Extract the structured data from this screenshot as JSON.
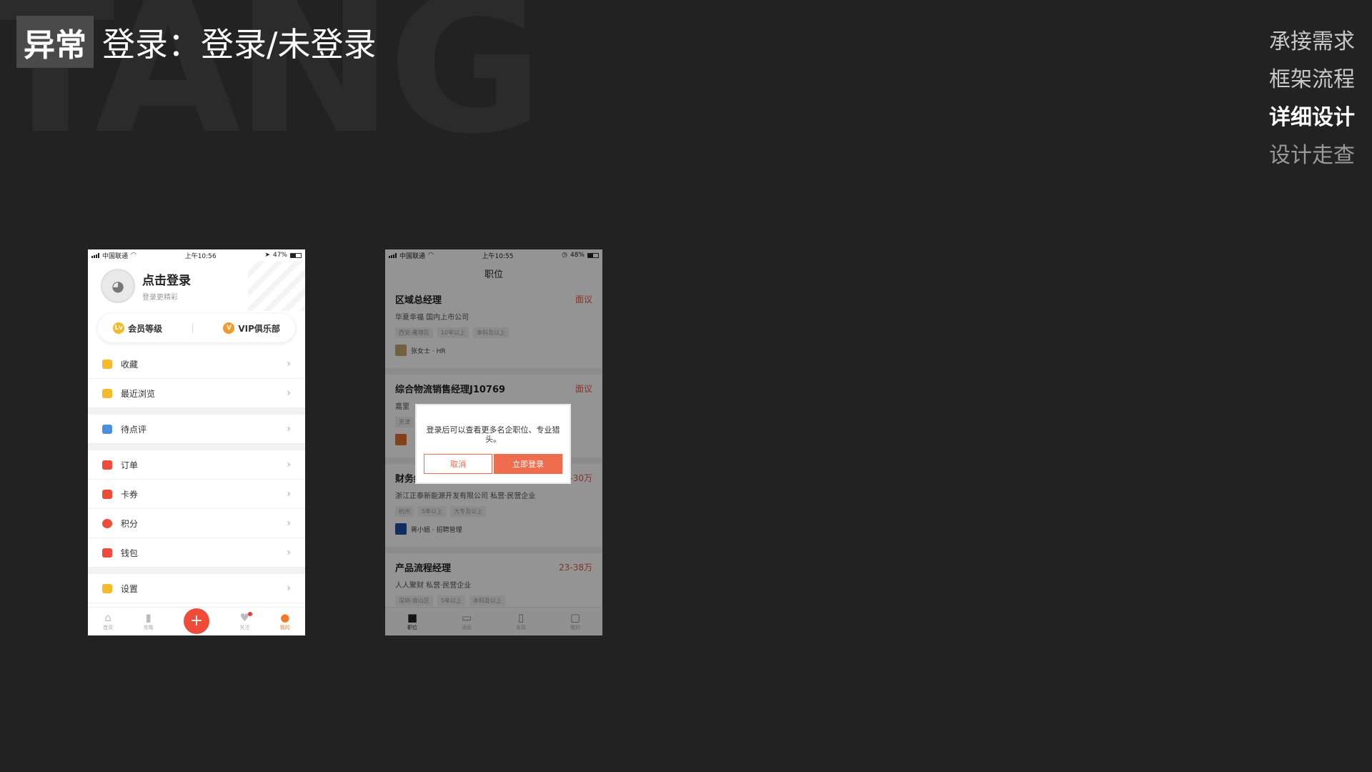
{
  "slide": {
    "watermark": "TANG",
    "tag": "异常",
    "title": "登录：登录/未登录"
  },
  "side_nav": [
    "承接需求",
    "框架流程",
    "详细设计",
    "设计走查"
  ],
  "phone1": {
    "status": {
      "carrier": "中国联通",
      "time": "上午10:56",
      "battery": "47%",
      "battery_level": 0.47
    },
    "profile": {
      "title": "点击登录",
      "subtitle": "登录更精彩",
      "avatar_icon": "avatar-icon"
    },
    "vip": {
      "level_label": "会员等级",
      "club_label": "VIP俱乐部",
      "level_badge": "Lv",
      "club_badge": "V"
    },
    "menu": [
      {
        "label": "收藏",
        "color": "#f5b92a"
      },
      {
        "label": "最近浏览",
        "color": "#f5b92a"
      },
      {
        "label": "待点评",
        "color": "#4a8fe0"
      },
      {
        "label": "订单",
        "color": "#ef4b38"
      },
      {
        "label": "卡券",
        "color": "#ef4b38"
      },
      {
        "label": "积分",
        "color": "#ef4b38"
      },
      {
        "label": "钱包",
        "color": "#ef4b38"
      },
      {
        "label": "设置",
        "color": "#f5b92a"
      }
    ],
    "tabs": [
      "首页",
      "攻略",
      "",
      "关注",
      "我的"
    ],
    "accent": "#f37a2a"
  },
  "phone2": {
    "status": {
      "carrier": "中国联通",
      "time": "上午10:55",
      "battery": "48%",
      "battery_level": 0.48
    },
    "title": "职位",
    "jobs": [
      {
        "title": "区域总经理",
        "salary": "面议",
        "company": "华夏幸福  国内上市公司",
        "tags": [
          "西安-雁塔区",
          "10年以上",
          "本科及以上"
        ],
        "hr": "张女士 · HR"
      },
      {
        "title": "综合物流销售经理J10769",
        "salary": "面议",
        "company": "嘉里",
        "tags": [
          "天津"
        ],
        "hr": ""
      },
      {
        "title": "财务经理（软件公司）",
        "salary": "18-30万",
        "company": "浙江正泰新能源开发有限公司  私营·民营企业",
        "tags": [
          "杭州",
          "5年以上",
          "大专及以上"
        ],
        "hr": "蒋小姐 · 招聘管理"
      },
      {
        "title": "产品流程经理",
        "salary": "23-38万",
        "company": "人人聚财  私营·民营企业",
        "tags": [
          "深圳-南山区",
          "5年以上",
          "本科及以上"
        ],
        "hr": ""
      }
    ],
    "dialog": {
      "message": "登录后可以查看更多名企职位、专业猎头。",
      "cancel": "取消",
      "confirm": "立即登录"
    },
    "tabs": [
      "职位",
      "消息",
      "发现",
      "我的"
    ],
    "accent": "#ef6d4c"
  }
}
